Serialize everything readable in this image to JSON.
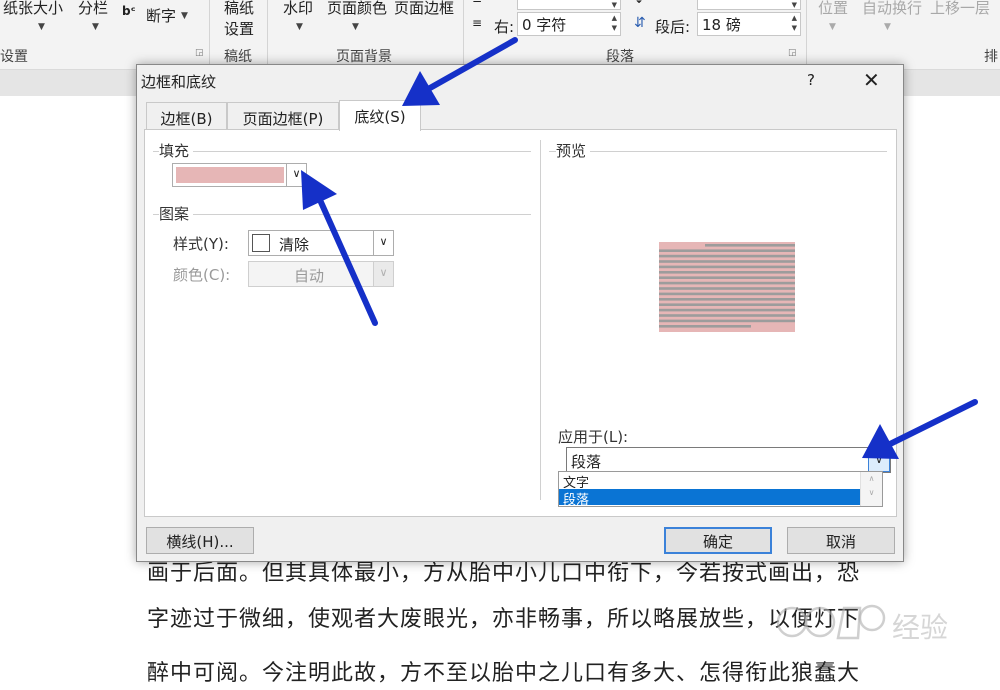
{
  "ribbon": {
    "page_size": "纸张大小",
    "columns": "分栏",
    "hyphenation": "断字",
    "group_page_setup": "设置",
    "manuscript_line1": "稿纸",
    "manuscript_line2": "设置",
    "group_manuscript": "稿纸",
    "watermark": "水印",
    "page_color": "页面颜色",
    "page_borders": "页面边框",
    "group_page_background": "页面背景",
    "indent_right_label": "右:",
    "indent_right_value": "0 字符",
    "spacing_after_label": "段后:",
    "spacing_after_value": "18 磅",
    "group_paragraph": "段落",
    "position": "位置",
    "wrap_text": "自动换行",
    "bring_forward": "上移一层",
    "group_arrange_partial": "排"
  },
  "document": {
    "lines": [
      "画于后面。但其具体最小，方从胎中小儿口中衔下，今若按式画出，恐",
      "字迹过于微细，使观者大废眼光，亦非畅事，所以略展放些，以便灯下",
      "醉中可阅。今注明此故，方不至以胎中之儿口有多大、怎得衔此狼蠢大"
    ]
  },
  "watermark_text": "经验",
  "dialog": {
    "title": "边框和底纹",
    "help": "?",
    "close": "✕",
    "tabs": [
      "边框(B)",
      "页面边框(P)",
      "底纹(S)"
    ],
    "fill_label": "填充",
    "fill_color": "#e6b6b6",
    "pattern_label": "图案",
    "style_label": "样式(Y):",
    "style_value": "清除",
    "color_label": "颜色(C):",
    "color_value": "自动",
    "preview_label": "预览",
    "apply_label": "应用于(L):",
    "apply_value": "段落",
    "apply_options": [
      "文字",
      "段落"
    ],
    "horizontal_line_button": "横线(H)...",
    "ok_button": "确定",
    "cancel_button": "取消"
  },
  "colors": {
    "annotation_arrow": "#1530c8",
    "selection": "#0a74d4",
    "preview_pink": "#e6b6b6",
    "preview_gray": "#9c9c9c"
  }
}
